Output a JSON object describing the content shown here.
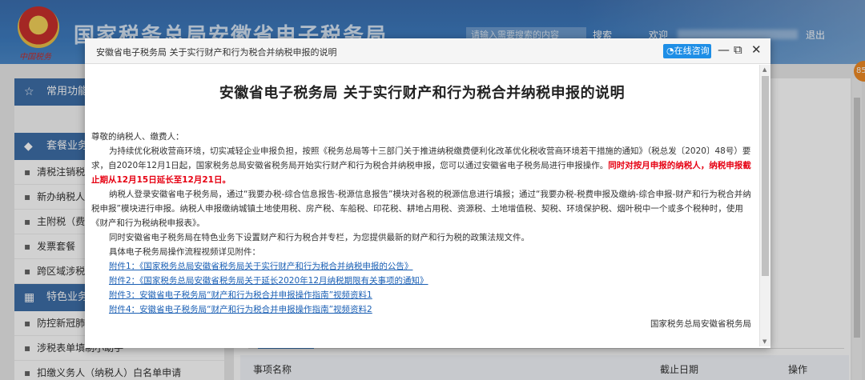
{
  "header": {
    "emblem_text": "中国税务",
    "site_title": "国家税务总局安徽省电子税务局",
    "search_placeholder": "请输入需要搜索的内容",
    "search_button": "搜索",
    "welcome": "欢迎",
    "logout": "退出"
  },
  "sidebar": {
    "common_title": "常用功能",
    "package_title": "套餐业务",
    "package_items": [
      "清税注销税（",
      "新办纳税人套",
      "主附税（费）",
      "发票套餐",
      "跨区域涉税事"
    ],
    "special_title": "特色业务",
    "special_items": [
      "防控新冠肺炎",
      "涉税表单填制小助手",
      "扣缴义务人（纳税人）白名单申请"
    ]
  },
  "main": {
    "table_headers": [
      "事项名称",
      "截止日期",
      "操作"
    ]
  },
  "badge": "85",
  "modal": {
    "window_title": "安徽省电子税务局 关于实行财产和行为税合并纳税申报的说明",
    "consult_button": "在线咨询",
    "doc_title": "安徽省电子税务局 关于实行财产和行为税合并纳税申报的说明",
    "greeting": "尊敬的纳税人、缴费人：",
    "para1_a": "为持续优化税收营商环境，切实减轻企业申报负担，按照《税务总局等十三部门关于推进纳税缴费便利化改革优化税收营商环境若干措施的通知》（税总发〔2020〕48号）要求，自2020年12月1日起，国家税务总局安徽省税务局开始实行财产和行为税合并纳税申报，您可以通过安徽省电子税务局进行申报操作。",
    "para1_red": "同时对按月申报的纳税人，纳税申报截止期从12月15日延长至12月21日。",
    "para2": "纳税人登录安徽省电子税务局，通过“我要办税-综合信息报告-税源信息报告”模块对各税的税源信息进行填报；通过“我要办税-税费申报及缴纳-综合申报-财产和行为税合并纳税申报”模块进行申报。纳税人申报缴纳城镇土地使用税、房产税、车船税、印花税、耕地占用税、资源税、土地增值税、契税、环境保护税、烟叶税中一个或多个税种时，使用《财产和行为税纳税申报表》。",
    "para3": "同时安徽省电子税务局在特色业务下设置财产和行为税合并专栏，为您提供最新的财产和行为税的政策法规文件。",
    "para4": "具体电子税务局操作流程视频详见附件：",
    "attachments": [
      "附件1：《国家税务总局安徽省税务局关于实行财产和行为税合并纳税申报的公告》",
      "附件2：《国家税务总局安徽省税务局关于延长2020年12月纳税期限有关事项的通知》",
      "附件3：安徽省电子税务局“财产和行为税合并申报操作指南”视频资料1",
      "附件4：安徽省电子税务局“财产和行为税合并申报操作指南”视频资料2"
    ],
    "signature": "国家税务总局安徽省税务局"
  },
  "colors": {
    "header_blue": "#3d7cc0",
    "sidebar_head": "#3d6ea8",
    "consult_blue": "#1e8ee6",
    "notice_red": "#e60012",
    "link_blue": "#1a5fb4"
  }
}
